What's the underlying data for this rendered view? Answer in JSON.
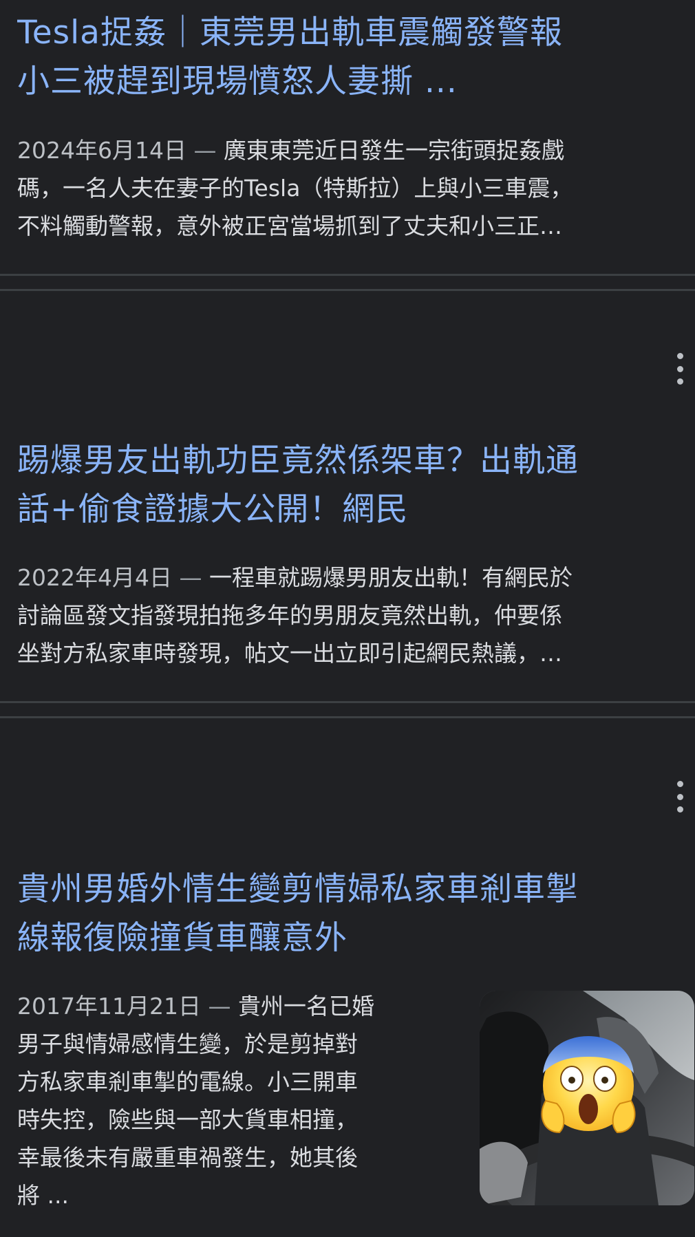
{
  "results": [
    {
      "title_lines": [
        "Tesla捉姦｜東莞男出軌車震觸發警報",
        "小三被趕到現場憤怒人妻撕 ..."
      ],
      "date": "2024年6月14日",
      "separator": "—",
      "snippet_lines": [
        "廣東東莞近日發生一宗街頭捉姦戲",
        "碼，一名人夫在妻子的Tesla（特斯拉）上與小三車震，",
        "不料觸動警報，意外被正宮當場抓到了丈夫和小三正…"
      ]
    },
    {
      "title_lines": [
        "踢爆男友出軌功臣竟然係架車？出軌通",
        "話+偷食證據大公開！網民"
      ],
      "date": "2022年4月4日",
      "separator": "—",
      "snippet_lines": [
        "一程車就踢爆男朋友出軌！有網民於",
        "討論區發文指發現拍拖多年的男朋友竟然出軌，仲要係",
        "坐對方私家車時發現，帖文一出立即引起網民熱議，…"
      ]
    },
    {
      "title_lines": [
        "貴州男婚外情生變剪情婦私家車剎車掣",
        "線報復險撞貨車釀意外"
      ],
      "date": "2017年11月21日",
      "separator": "—",
      "snippet_lines": [
        "貴州一名已婚",
        "男子與情婦感情生變，於是剪掉對",
        "方私家車剎車掣的電線。小三開車",
        "時失控，險些與一部大貨車相撞，",
        "幸最後未有嚴重車禍發生，她其後",
        "將 ..."
      ],
      "thumbnail_emoji": "😱"
    }
  ],
  "icons": {
    "more_options": "more-vert-icon"
  },
  "colors": {
    "background": "#202124",
    "title": "#8ab4f8",
    "snippet": "#dadce0",
    "divider": "#3c4043"
  }
}
